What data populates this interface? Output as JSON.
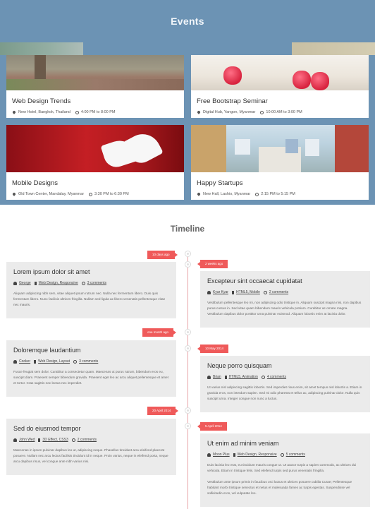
{
  "events": {
    "title": "Events",
    "cards": [
      {
        "title": "Web Design Trends",
        "location": "New Hotel, Bangkok, Thailand",
        "time": "4:00 PM to 8:00 PM"
      },
      {
        "title": "Free Bootstrap Seminar",
        "location": "Digital Hub, Yangon, Myanmar",
        "time": "10:00 AM to 3:00 PM"
      },
      {
        "title": "Mobile Designs",
        "location": "Old Town Center, Mandalay, Myanmar",
        "time": "3:30 PM to 6:30 PM"
      },
      {
        "title": "Happy Startups",
        "location": "New Hall, Lashio, Myanmar",
        "time": "2:15 PM to 5:15 PM"
      }
    ]
  },
  "timeline": {
    "title": "Timeline",
    "posts": [
      {
        "date": "10 days ago",
        "title": "Lorem ipsum dolor sit amet",
        "author": "George",
        "categories": "Web Design, Responsive",
        "comments": "3 comments",
        "paragraphs": [
          "Aliquam adipiscing nibh sem, vitae aliquet ipsum rutrum nec. Nulla nec fermentum libero. Duis quis fermentum libero. Nunc facilisis ultrices fringilla. Nullam sed ligula ac libero venenatis pellentesque vitae nec mauris."
        ]
      },
      {
        "date": "2 weeks ago",
        "title": "Excepteur sint occaecat cupidatat",
        "author": "Kyar Kyar",
        "categories": "HTML5, Mobile",
        "comments": "2 comments",
        "paragraphs": [
          "Vestibulum pellentesque leo mi, non adipiscing odio tristique in. Aliquam suscipit magna nisi, non dapibus purus cursus in. Sed vitae quam bibendum mauris vehicula pretium. Curabitur ac ornare magna. Vestibulum dapibus dolor porttitor urna pulvinar euismod. Aliquam lobortis enim at lacinia dolor."
        ]
      },
      {
        "date": "one month ago",
        "title": "Doloremque laudantium",
        "author": "Cooker",
        "categories": "Web Design, Layout",
        "comments": "3 comments",
        "paragraphs": [
          "Fusce feugiat sem dolor. Curabitur a consectetur quam. Maecenas ut purus rutrum, bibendum eros eu, suscipit diam. Praesent semper bibendum gravida. Praesent eget leo ac arcu aliquet pellentesque et amet et tortor. Cras sagittis nec lectus nec imperdiet."
        ]
      },
      {
        "date": "10 May 2014",
        "title": "Neque porro quisquam",
        "author": "Brian",
        "categories": "HTML5, Animation",
        "comments": "4 comments",
        "paragraphs": [
          "Ut varius nisl adipiscing sagittis lobortis. Sed imperdiet risus enim, sit amet tempus nisl lobortis a. Etiam in gravida eros, non interdum sapien. Sed mi odio pharetra et tellus ac, adipiscing pulvinar dolor. Nulla quis suscipit urna. Integer congue non nunc a luctus."
        ]
      },
      {
        "date": "20 April 2014",
        "title": "Sed do eiusmod tempor",
        "author": "John Wed",
        "categories": "3D Effect, CSS3",
        "comments": "2 comments",
        "paragraphs": [
          "Maecenas in ipsum pulvinar dapibus leo ut, adipiscing neque. Phasellus tincidunt arcu eleifend placerat posuere. Nullam nec arcu lectus facilisis tincidunt id in neque. Proin varius, neque in eleifend porta, neque arcu dapibus risus, vel congue ante nibh varius nisi."
        ]
      },
      {
        "date": "5 April 2014",
        "title": "Ut enim ad minim veniam",
        "author": "Moon Plus",
        "categories": "Web Design, Responsive",
        "comments": "5 comments",
        "paragraphs": [
          "Duis lacinia leo erat, eu tincidunt mauris congue ut. Ut auctor turpis a sapien commodo, ac ultrices dui vehicula. Etiam in tristique felis. Sed eleifend turpis sed purus venenatis fringilla.",
          "Vestibulum ante ipsum primis in faucibus orci luctus et ultrices posuere cubilia Curae; Pellentesque habitant morbi tristique senectus et netus et malesuada fames ac turpis egestas. Suspendisse vel sollicitudin eros, vel vulputate leo."
        ]
      }
    ]
  }
}
